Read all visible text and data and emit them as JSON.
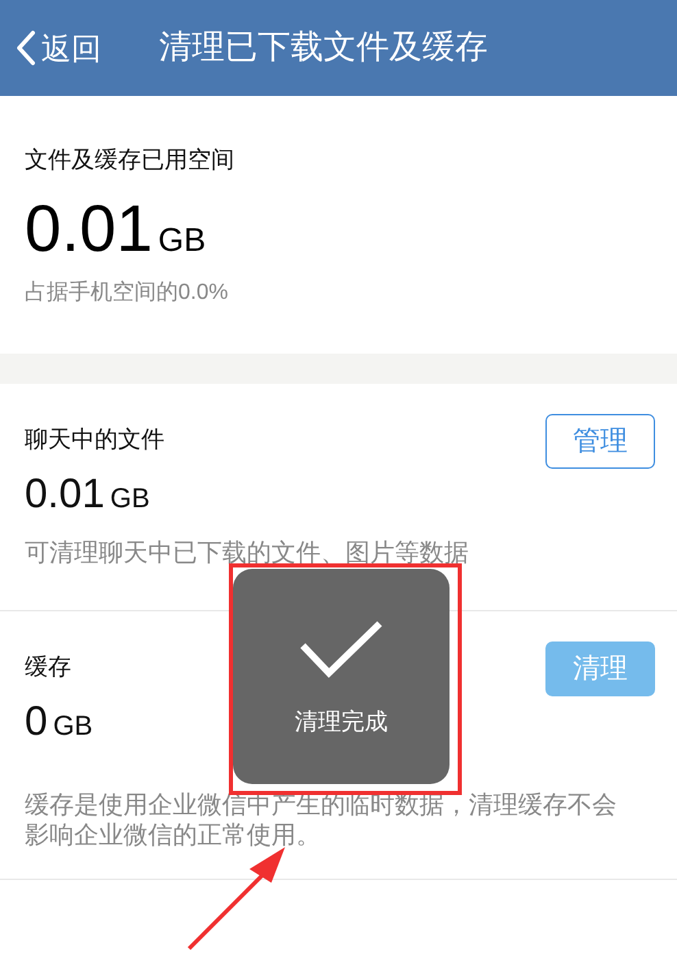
{
  "nav_bar": {
    "back_label": "返回",
    "title": "清理已下载文件及缓存"
  },
  "summary": {
    "label": "文件及缓存已用空间",
    "value": "0.01",
    "unit": "GB",
    "note": "占据手机空间的0.0%"
  },
  "sections": [
    {
      "label": "聊天中的文件",
      "value": "0.01",
      "unit": "GB",
      "description": "可清理聊天中已下载的文件、图片等数据",
      "button": {
        "label": "管理",
        "kind": "outline",
        "disabled": false
      }
    },
    {
      "label": "缓存",
      "value": "0",
      "unit": "GB",
      "description": "缓存是使用企业微信中产生的临时数据，清理缓存不会影响企业微信的正常使用。",
      "button": {
        "label": "清理",
        "kind": "filled",
        "disabled": true
      }
    }
  ],
  "toast": {
    "message": "清理完成"
  }
}
